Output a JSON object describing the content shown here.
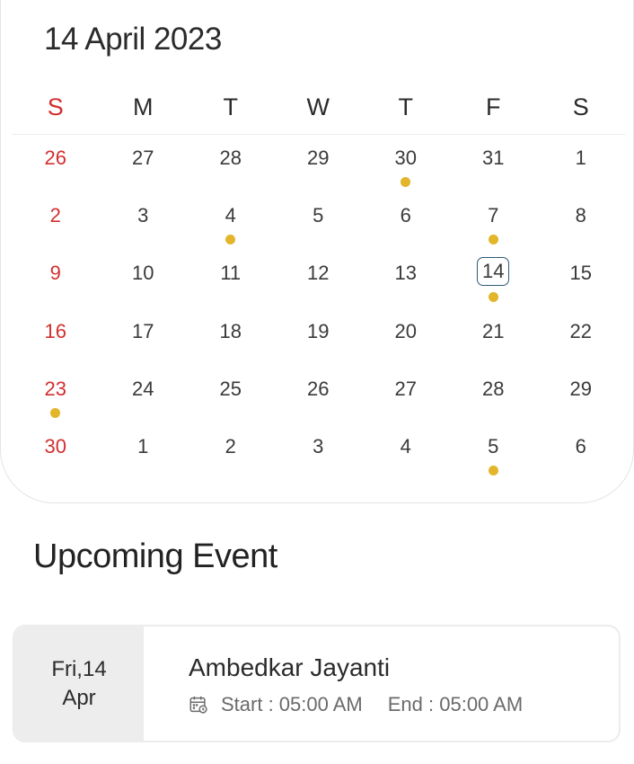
{
  "calendar": {
    "title": "14 April 2023",
    "weekdays": [
      "S",
      "M",
      "T",
      "W",
      "T",
      "F",
      "S"
    ],
    "weeks": [
      [
        {
          "d": "26"
        },
        {
          "d": "27"
        },
        {
          "d": "28"
        },
        {
          "d": "29"
        },
        {
          "d": "30",
          "dot": true
        },
        {
          "d": "31"
        },
        {
          "d": "1"
        }
      ],
      [
        {
          "d": "2"
        },
        {
          "d": "3"
        },
        {
          "d": "4",
          "dot": true
        },
        {
          "d": "5"
        },
        {
          "d": "6"
        },
        {
          "d": "7",
          "dot": true
        },
        {
          "d": "8"
        }
      ],
      [
        {
          "d": "9"
        },
        {
          "d": "10"
        },
        {
          "d": "11"
        },
        {
          "d": "12"
        },
        {
          "d": "13"
        },
        {
          "d": "14",
          "dot": true,
          "selected": true
        },
        {
          "d": "15"
        }
      ],
      [
        {
          "d": "16"
        },
        {
          "d": "17"
        },
        {
          "d": "18"
        },
        {
          "d": "19"
        },
        {
          "d": "20"
        },
        {
          "d": "21"
        },
        {
          "d": "22"
        }
      ],
      [
        {
          "d": "23",
          "dot": true
        },
        {
          "d": "24"
        },
        {
          "d": "25"
        },
        {
          "d": "26"
        },
        {
          "d": "27"
        },
        {
          "d": "28"
        },
        {
          "d": "29"
        }
      ],
      [
        {
          "d": "30"
        },
        {
          "d": "1"
        },
        {
          "d": "2"
        },
        {
          "d": "3"
        },
        {
          "d": "4"
        },
        {
          "d": "5",
          "dot": true
        },
        {
          "d": "6"
        }
      ]
    ]
  },
  "upcoming": {
    "title": "Upcoming Event",
    "event": {
      "date_line1": "Fri,14",
      "date_line2": "Apr",
      "name": "Ambedkar Jayanti",
      "start": "Start : 05:00 AM",
      "end": "End : 05:00 AM",
      "icon": "calendar-clock-icon"
    }
  },
  "colors": {
    "sunday": "#d32f2f",
    "event_dot": "#e2b52a",
    "selected_border": "#2e5a76"
  }
}
